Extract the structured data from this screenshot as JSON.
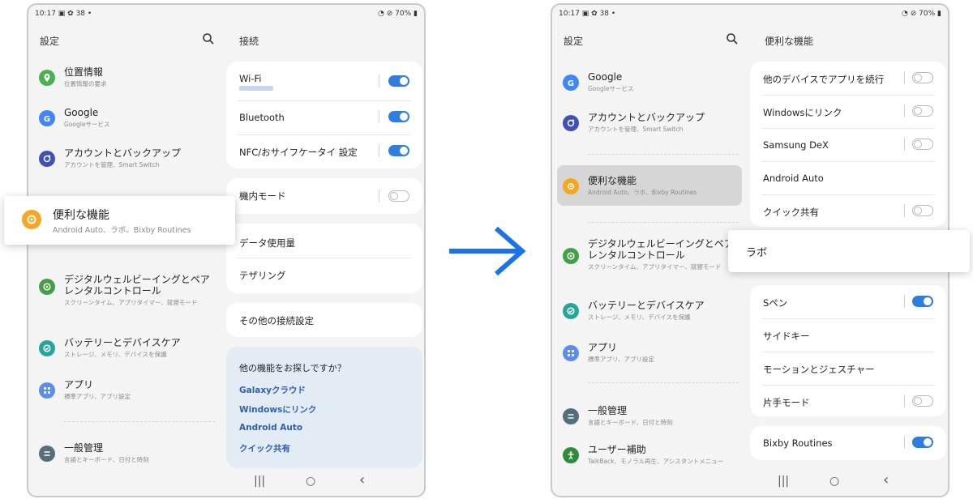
{
  "status": {
    "time": "10:17",
    "left_extra": "38 •",
    "right": "70%"
  },
  "left": {
    "panel_title": "設定",
    "items": [
      {
        "title": "位置情報",
        "sub": "位置情報の要求",
        "color": "#4caf50",
        "icon": "location"
      },
      {
        "title": "Google",
        "sub": "Googleサービス",
        "color": "#4285f4",
        "icon": "google"
      },
      {
        "title": "アカウントとバックアップ",
        "sub": "アカウントを管理、Smart Switch",
        "color": "#3f51b5",
        "icon": "sync"
      },
      {
        "title": "デジタルウェルビーイングとペアレンタルコントロール",
        "sub": "スクリーンタイム、アプリタイマー、就寝モード",
        "color": "#43a047",
        "icon": "wellbeing"
      },
      {
        "title": "バッテリーとデバイスケア",
        "sub": "ストレージ、メモリ、デバイスを保護",
        "color": "#26a69a",
        "icon": "care"
      },
      {
        "title": "アプリ",
        "sub": "標準アプリ、アプリ設定",
        "color": "#5c8de8",
        "icon": "apps"
      },
      {
        "title": "一般管理",
        "sub": "言語とキーボード、日付と時刻",
        "color": "#546e7a",
        "icon": "general"
      }
    ],
    "popup": {
      "title": "便利な機能",
      "sub": "Android Auto、ラボ、Bixby Routines",
      "color": "#f5a623"
    },
    "right_title": "接続",
    "card1": [
      {
        "label": "Wi-Fi",
        "toggle": "on"
      },
      {
        "label": "Bluetooth",
        "toggle": "on"
      },
      {
        "label": "NFC/おサイフケータイ 設定",
        "toggle": "on"
      }
    ],
    "card2": [
      {
        "label": "機内モード",
        "toggle": "off"
      }
    ],
    "card3": [
      {
        "label": "データ使用量"
      },
      {
        "label": "テザリング"
      }
    ],
    "card4": [
      {
        "label": "その他の接続設定"
      }
    ],
    "suggest": {
      "title": "他の機能をお探しですか？",
      "links": [
        "Galaxyクラウド",
        "Windowsにリンク",
        "Android Auto",
        "クイック共有"
      ]
    }
  },
  "arrow_color": "#1a73e8",
  "right": {
    "panel_title": "設定",
    "items": [
      {
        "title": "Google",
        "sub": "Googleサービス",
        "color": "#4285f4",
        "icon": "google"
      },
      {
        "title": "アカウントとバックアップ",
        "sub": "アカウントを管理、Smart Switch",
        "color": "#3f51b5",
        "icon": "sync"
      },
      {
        "title": "便利な機能",
        "sub": "Android Auto、ラボ、Bixby Routines",
        "color": "#f5a623",
        "icon": "advanced"
      },
      {
        "title": "デジタルウェルビーイングとペアレンタルコントロール",
        "sub": "スクリーンタイム、アプリタイマー、就寝モード",
        "color": "#43a047",
        "icon": "wellbeing"
      },
      {
        "title": "バッテリーとデバイスケア",
        "sub": "ストレージ、メモリ、デバイスを保護",
        "color": "#26a69a",
        "icon": "care"
      },
      {
        "title": "アプリ",
        "sub": "標準アプリ、アプリ設定",
        "color": "#5c8de8",
        "icon": "apps"
      },
      {
        "title": "一般管理",
        "sub": "言語とキーボード、日付と時刻",
        "color": "#546e7a",
        "icon": "general"
      },
      {
        "title": "ユーザー補助",
        "sub": "TalkBack、モノラル再生、アシスタントメニュー",
        "color": "#2e8b3a",
        "icon": "accessibility"
      }
    ],
    "right_title": "便利な機能",
    "card1": [
      {
        "label": "他のデバイスでアプリを続行",
        "toggle": "off"
      },
      {
        "label": "Windowsにリンク",
        "toggle": "off"
      },
      {
        "label": "Samsung DeX",
        "toggle": "off"
      },
      {
        "label": "Android Auto"
      },
      {
        "label": "クイック共有",
        "toggle": "off"
      }
    ],
    "popup": {
      "label": "ラボ"
    },
    "card2": [
      {
        "label": "Sペン",
        "toggle": "on"
      },
      {
        "label": "サイドキー"
      },
      {
        "label": "モーションとジェスチャー"
      },
      {
        "label": "片手モード",
        "toggle": "off"
      }
    ],
    "card3": [
      {
        "label": "Bixby Routines",
        "toggle": "on"
      }
    ]
  },
  "nav": {
    "recents": "|||",
    "home": "○",
    "back": "‹"
  }
}
